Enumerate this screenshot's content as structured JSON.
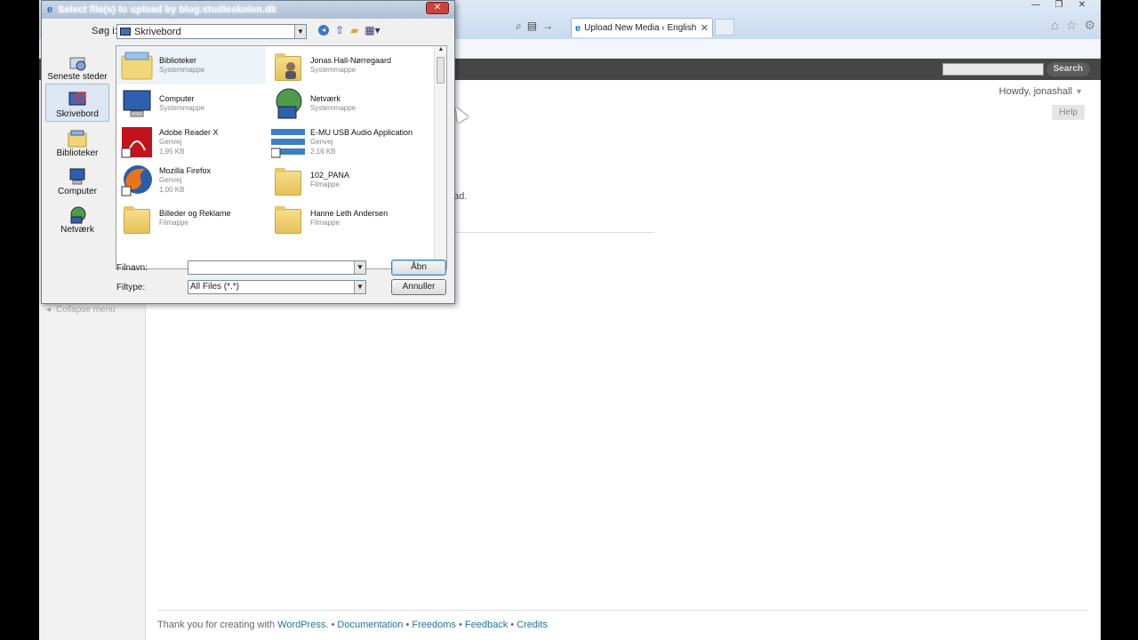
{
  "browser": {
    "tab_title": "Upload New Media ‹ English ...",
    "tab_close": "✕"
  },
  "wordpress": {
    "search_button": "Search",
    "howdy": "Howdy, jonashall",
    "help": "Help",
    "fragment_text": "ead.",
    "collapse_menu": "Collapse menu",
    "footer": {
      "prefix": "Thank you for creating with",
      "wordpress": "WordPress.",
      "sep": "•",
      "documentation": "Documentation",
      "freedoms": "Freedoms",
      "feedback": "Feedback",
      "credits": "Credits"
    }
  },
  "dialog": {
    "title": "Select file(s) to upload by blog.studieskolen.dk",
    "close": "✕",
    "lookin_label": "Søg i:",
    "lookin_value": "Skrivebord",
    "places": [
      {
        "label": "Seneste steder",
        "icon": "recent-places-icon"
      },
      {
        "label": "Skrivebord",
        "icon": "desktop-icon"
      },
      {
        "label": "Biblioteker",
        "icon": "libraries-icon"
      },
      {
        "label": "Computer",
        "icon": "computer-icon"
      },
      {
        "label": "Netværk",
        "icon": "network-icon"
      }
    ],
    "items": [
      {
        "name": "Biblioteker",
        "line1": "Systemmappe",
        "line2": "",
        "icon": "libraries-folder-icon"
      },
      {
        "name": "Jonas Hall-Nørregaard",
        "line1": "Systemmappe",
        "line2": "",
        "icon": "user-folder-icon"
      },
      {
        "name": "Computer",
        "line1": "Systemmappe",
        "line2": "",
        "icon": "computer-icon"
      },
      {
        "name": "Netværk",
        "line1": "Systemmappe",
        "line2": "",
        "icon": "network-icon"
      },
      {
        "name": "Adobe Reader X",
        "line1": "Genvej",
        "line2": "1,95 KB",
        "icon": "adobe-reader-icon"
      },
      {
        "name": "E-MU USB Audio Application",
        "line1": "Genvej",
        "line2": "2,16 KB",
        "icon": "emu-audio-icon"
      },
      {
        "name": "Mozilla Firefox",
        "line1": "Genvej",
        "line2": "1,00 KB",
        "icon": "firefox-icon"
      },
      {
        "name": "102_PANA",
        "line1": "Filmappe",
        "line2": "",
        "icon": "folder-icon"
      },
      {
        "name": "Billeder og Reklame",
        "line1": "Filmappe",
        "line2": "",
        "icon": "folder-icon"
      },
      {
        "name": "Hanne Leth Andersen",
        "line1": "Filmappe",
        "line2": "",
        "icon": "folder-icon"
      }
    ],
    "filename_label": "Filnavn:",
    "filename_value": "",
    "filetype_label": "Filtype:",
    "filetype_value": "All Files (*.*)",
    "open_button": "Åbn",
    "cancel_button": "Annuller"
  }
}
